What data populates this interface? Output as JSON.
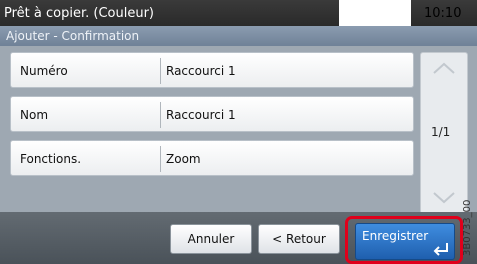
{
  "status": {
    "message": "Prêt à copier. (Couleur)",
    "time": "10:10"
  },
  "title": "Ajouter - Confirmation",
  "rows": [
    {
      "label": "Numéro",
      "value": "Raccourci 1"
    },
    {
      "label": "Nom",
      "value": "Raccourci 1"
    },
    {
      "label": "Fonctions.",
      "value": "Zoom"
    }
  ],
  "pager": {
    "indicator": "1/1"
  },
  "buttons": {
    "cancel": "Annuler",
    "back": "< Retour",
    "save": "Enregistrer"
  },
  "figure_code": "3B0733_00",
  "colors": {
    "highlight": "#e0001b",
    "save_button": "#2f74c8",
    "title_bar": "#7d8ea3"
  },
  "icons": {
    "scroll_up": "chevron-up-icon",
    "scroll_down": "chevron-down-icon",
    "enter": "enter-arrow-icon"
  }
}
